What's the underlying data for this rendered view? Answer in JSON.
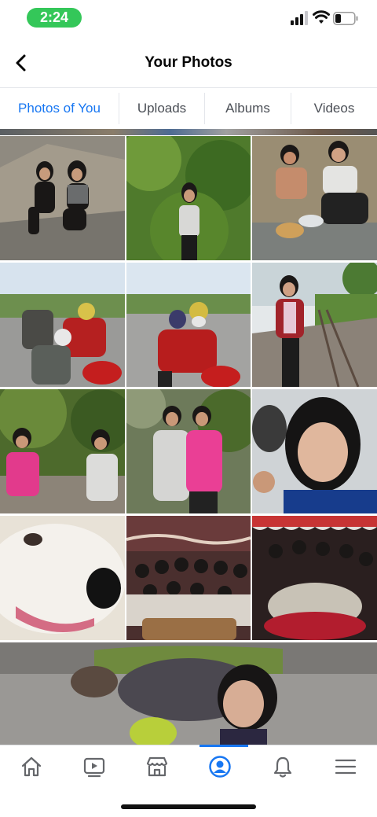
{
  "status_bar": {
    "time": "2:24",
    "time_pill_color": "#34c759"
  },
  "header": {
    "title": "Your Photos",
    "back_icon": "chevron-left-icon"
  },
  "tabs": [
    {
      "label": "Photos of You",
      "active": true
    },
    {
      "label": "Uploads",
      "active": false
    },
    {
      "label": "Albums",
      "active": false
    },
    {
      "label": "Videos",
      "active": false
    }
  ],
  "accent_color": "#1877f2",
  "bottom_nav": [
    {
      "icon": "home-icon",
      "active": false
    },
    {
      "icon": "watch-video-icon",
      "active": false
    },
    {
      "icon": "marketplace-icon",
      "active": false
    },
    {
      "icon": "profile-icon",
      "active": true
    },
    {
      "icon": "bell-icon",
      "active": false
    },
    {
      "icon": "menu-icon",
      "active": false
    }
  ]
}
